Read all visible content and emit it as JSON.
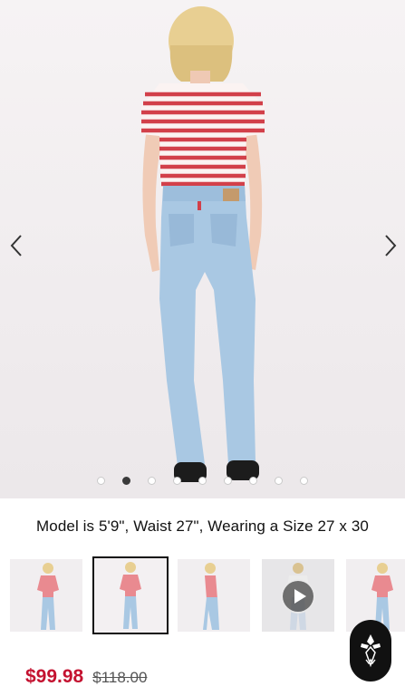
{
  "gallery": {
    "total_slides": 9,
    "active_index": 1,
    "prev_icon": "chevron-left-icon",
    "next_icon": "chevron-right-icon"
  },
  "caption": "Model is 5'9\", Waist 27\", Wearing a Size 27 x 30",
  "thumbnails": [
    {
      "view": "front",
      "selected": false,
      "video": false
    },
    {
      "view": "back",
      "selected": true,
      "video": false
    },
    {
      "view": "side",
      "selected": false,
      "video": false
    },
    {
      "view": "video",
      "selected": false,
      "video": true,
      "icon": "play-icon"
    },
    {
      "view": "front-close",
      "selected": false,
      "video": false
    }
  ],
  "price": {
    "sale": "$99.98",
    "original": "$118.00",
    "sale_color": "#c41230"
  },
  "badge_icon": "ai-assistant-icon",
  "colors": {
    "denim": "#a9c8e3",
    "shirt_stripe": "#d2404a",
    "accent": "#c41230"
  }
}
